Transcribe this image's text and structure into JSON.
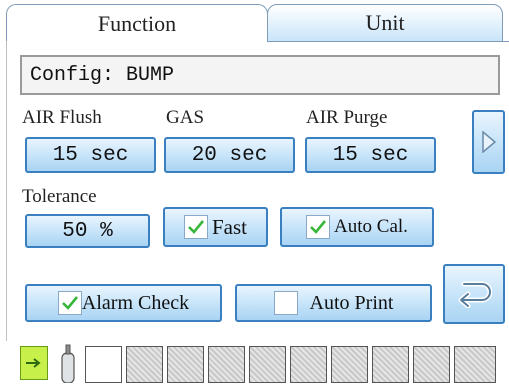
{
  "tabs": [
    {
      "label": "Function",
      "active": true
    },
    {
      "label": "Unit",
      "active": false
    }
  ],
  "config": {
    "value": "Config: BUMP"
  },
  "labels": {
    "air_flush": "AIR Flush",
    "gas": "GAS",
    "air_purge": "AIR Purge",
    "tolerance": "Tolerance"
  },
  "values": {
    "air_flush": "15 sec",
    "gas": "20 sec",
    "air_purge": "15 sec",
    "tolerance": "50 %"
  },
  "checkboxes": {
    "fast": {
      "label": "Fast",
      "checked": true
    },
    "auto_cal": {
      "label": "Auto Cal.",
      "checked": true
    },
    "alarm_check": {
      "label": "Alarm Check",
      "checked": true
    },
    "auto_print": {
      "label": "Auto Print",
      "checked": false
    }
  },
  "icons": {
    "next": "triangle-right-icon",
    "back": "return-arrow-icon",
    "status_green": "green-status-icon",
    "cylinder": "gas-cylinder-icon"
  },
  "colors": {
    "accent": "#3a7fc0",
    "button_fill": "#cbe6fa",
    "check": "#38b63a",
    "status_green": "#c7f04a"
  }
}
